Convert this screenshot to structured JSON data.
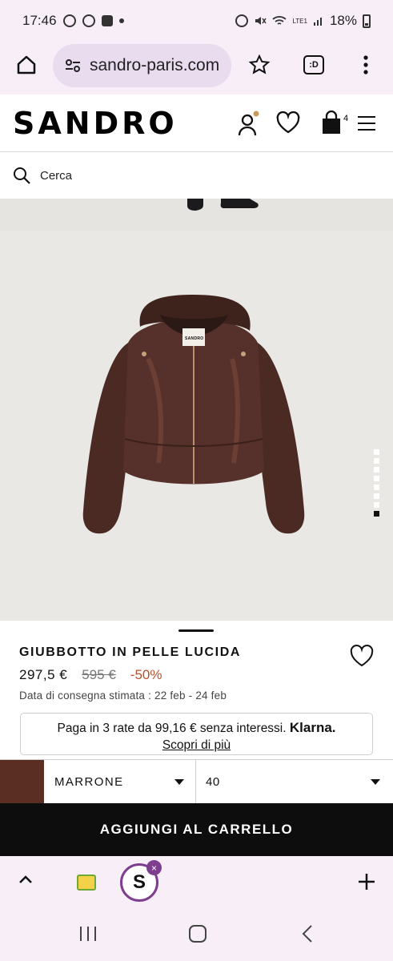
{
  "status_bar": {
    "time": "17:46",
    "battery": "18%",
    "network": "LTE1"
  },
  "browser": {
    "url": "sandro-paris.com",
    "tab_count_icon": ":D"
  },
  "header": {
    "logo": "SANDRO",
    "cart_count": "4"
  },
  "search": {
    "label": "Cerca"
  },
  "gallery": {
    "image_count": 8,
    "active_index": 7,
    "jacket_label": "SANDRO"
  },
  "product": {
    "name": "GIUBBOTTO IN PELLE LUCIDA",
    "price": "297,5 €",
    "old_price": "595 €",
    "discount": "-50%",
    "delivery": "Data di consegna stimata : 22 feb - 24 feb"
  },
  "klarna": {
    "text": "Paga in 3 rate da 99,16 € senza interessi.",
    "brand": "Klarna.",
    "link": "Scopri di più"
  },
  "selectors": {
    "color": "MARRONE",
    "size": "40",
    "swatch_color": "#5a2e22"
  },
  "cta": {
    "add_to_cart": "AGGIUNGI AL CARRELLO"
  },
  "tabs": {
    "active_letter": "S",
    "close_symbol": "×"
  },
  "colors": {
    "accent": "#7e3e8f",
    "discount": "#b5522f",
    "chrome": "#f7eef8"
  }
}
